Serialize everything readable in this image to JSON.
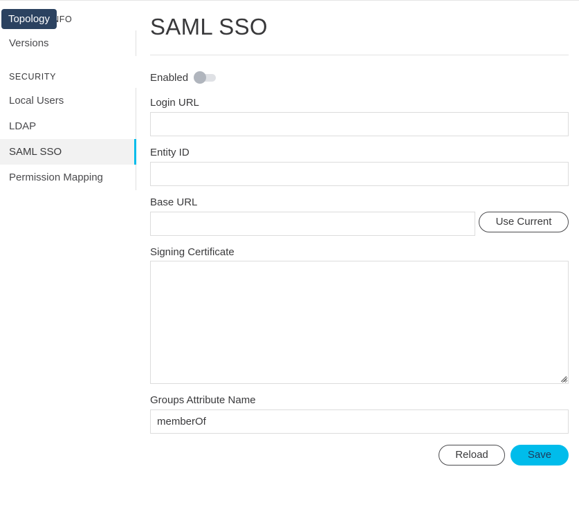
{
  "sidebar": {
    "sections": [
      {
        "header": "SYSTEM INFO",
        "items": [
          {
            "label": "Versions",
            "active": false
          }
        ]
      },
      {
        "header": "SECURITY",
        "items": [
          {
            "label": "Local Users",
            "active": false
          },
          {
            "label": "LDAP",
            "active": false
          },
          {
            "label": "SAML SSO",
            "active": true
          },
          {
            "label": "Permission Mapping",
            "active": false
          }
        ]
      }
    ]
  },
  "tooltip": {
    "text": "Topology"
  },
  "main": {
    "title": "SAML SSO",
    "enabled": {
      "label": "Enabled",
      "value": false
    },
    "fields": {
      "login_url": {
        "label": "Login URL",
        "value": "",
        "placeholder": ""
      },
      "entity_id": {
        "label": "Entity ID",
        "value": "",
        "placeholder": ""
      },
      "base_url": {
        "label": "Base URL",
        "value": "",
        "placeholder": "",
        "button_label": "Use Current"
      },
      "signing_certificate": {
        "label": "Signing Certificate",
        "value": ""
      },
      "groups_attribute_name": {
        "label": "Groups Attribute Name",
        "value": "memberOf"
      }
    },
    "actions": {
      "reload_label": "Reload",
      "save_label": "Save"
    }
  },
  "colors": {
    "accent": "#00bceb",
    "tooltip_bg": "#2b4260",
    "active_item_bg": "#f2f2f2"
  }
}
